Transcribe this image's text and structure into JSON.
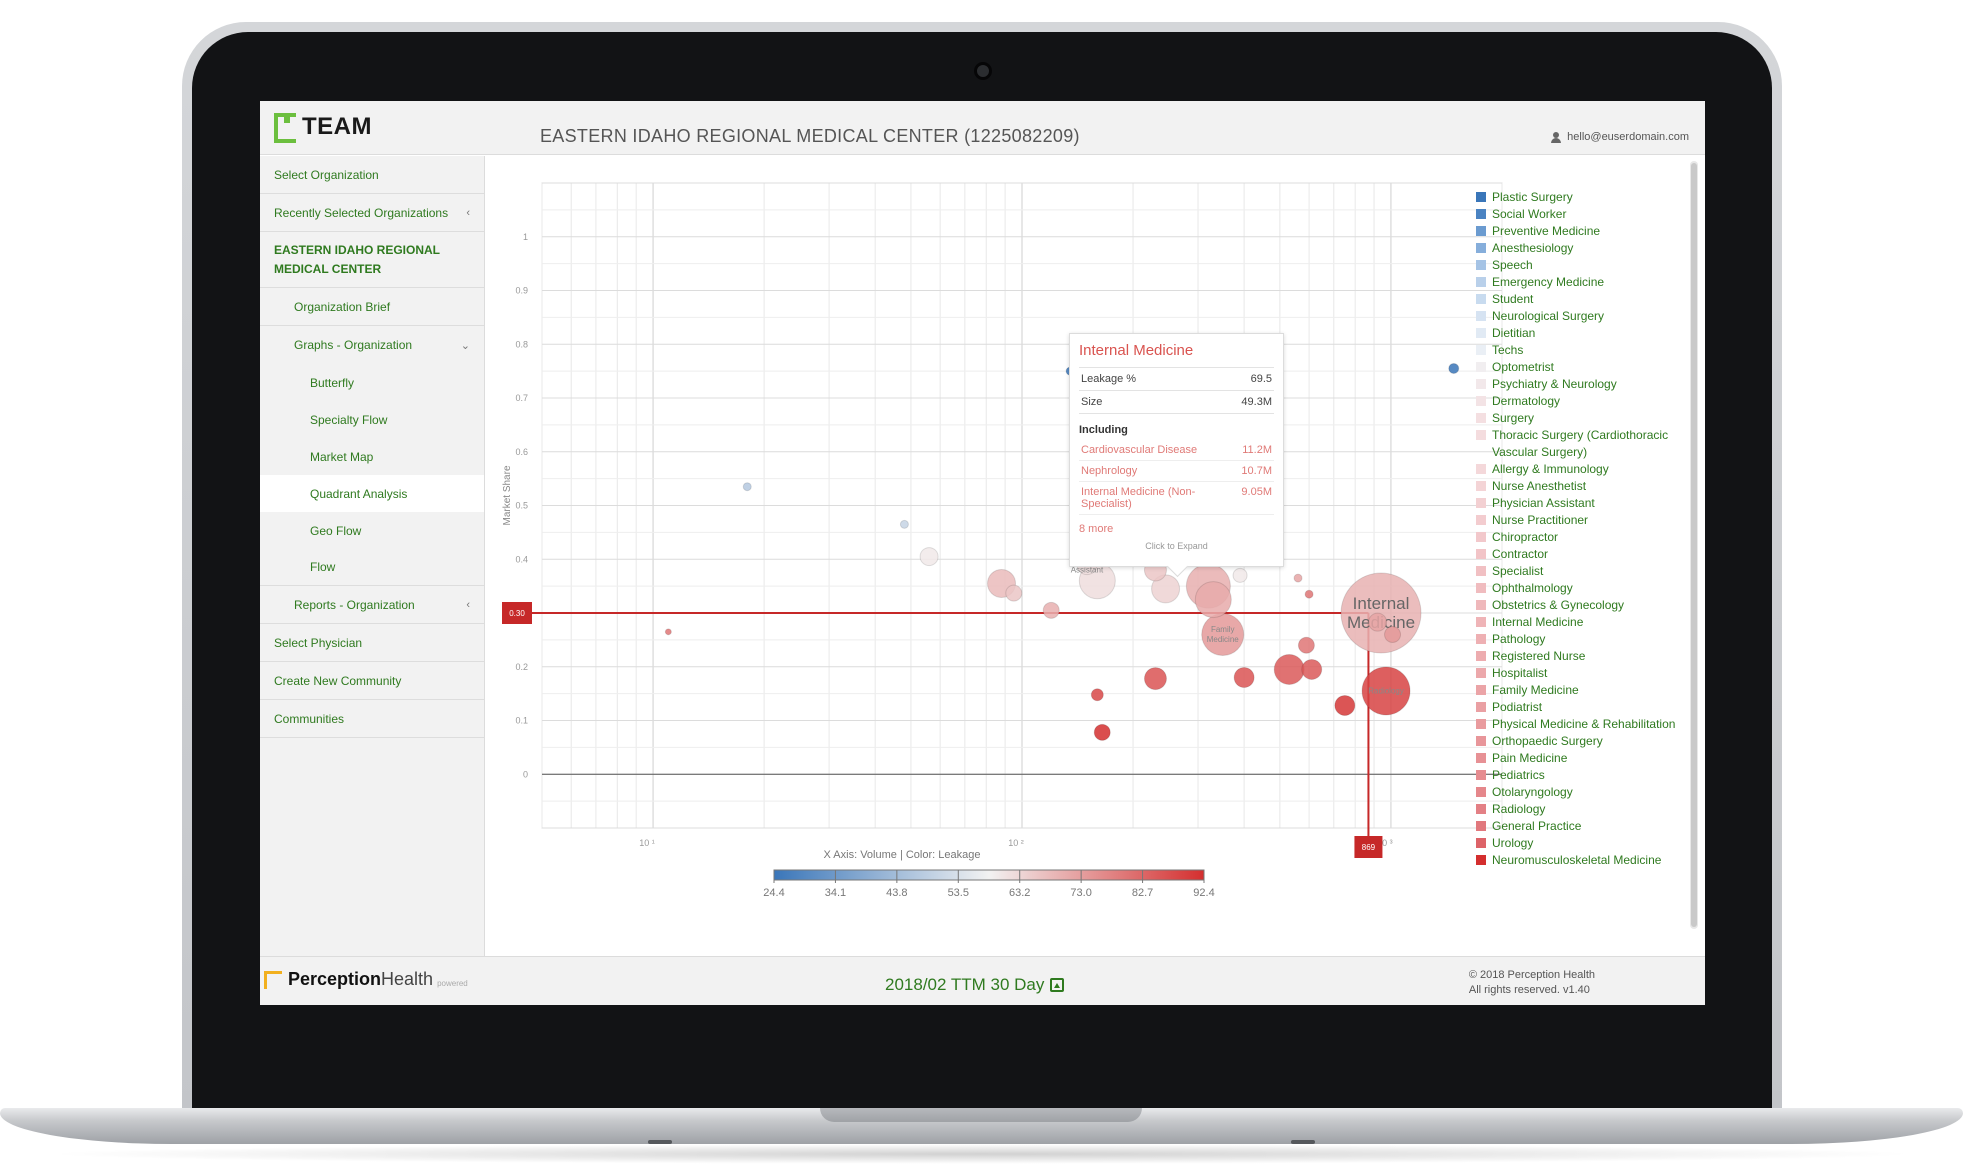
{
  "header": {
    "logo_text": "TEAM",
    "org_title": "EASTERN IDAHO REGIONAL MEDICAL CENTER (1225082209)",
    "user_email": "hello@euserdomain.com"
  },
  "sidebar": {
    "items": [
      {
        "label": "Select Organization"
      },
      {
        "label": "Recently Selected Organizations",
        "caret": "‹"
      },
      {
        "label": "EASTERN IDAHO REGIONAL MEDICAL CENTER"
      },
      {
        "label": "Organization Brief"
      },
      {
        "label": "Graphs - Organization",
        "caret": "⌄"
      },
      {
        "label": "Butterfly"
      },
      {
        "label": "Specialty Flow"
      },
      {
        "label": "Market Map"
      },
      {
        "label": "Quadrant Analysis"
      },
      {
        "label": "Geo Flow"
      },
      {
        "label": "Flow"
      },
      {
        "label": "Reports - Organization",
        "caret": "‹"
      },
      {
        "label": "Select Physician"
      },
      {
        "label": "Create New Community"
      },
      {
        "label": "Communities"
      }
    ]
  },
  "tooltip": {
    "title": "Internal Medicine",
    "leakage_label": "Leakage %",
    "leakage_value": "69.5",
    "size_label": "Size",
    "size_value": "49.3M",
    "including_label": "Including",
    "sub_items": [
      {
        "name": "Cardiovascular Disease",
        "value": "11.2M"
      },
      {
        "name": "Nephrology",
        "value": "10.7M"
      },
      {
        "name": "Internal Medicine (Non-Specialist)",
        "value": "9.05M"
      }
    ],
    "more": "8 more",
    "expand": "Click to Expand"
  },
  "footer": {
    "brand_bold": "Perception",
    "brand_light": "Health",
    "powered": "powered",
    "period": "2018/02 TTM 30 Day",
    "copyright_line1": "© 2018 Perception Health",
    "copyright_line2": "All rights reserved. v1.40"
  },
  "chart_data": {
    "type": "scatter",
    "xlabel": "X Axis: Volume | Color: Leakage",
    "ylabel": "Market Share",
    "x_scale": "log",
    "xlim": [
      5,
      2000
    ],
    "ylim": [
      -0.1,
      1.1
    ],
    "x_ticks": [
      {
        "value": 10,
        "label": "10 ¹"
      },
      {
        "value": 100,
        "label": "10 ²"
      },
      {
        "value": 1000,
        "label": "10 ³"
      }
    ],
    "y_ticks": [
      0,
      0.1,
      0.2,
      0.3,
      0.4,
      0.5,
      0.6,
      0.7,
      0.8,
      0.9,
      1
    ],
    "crosshair": {
      "x": 869,
      "y": 0.3,
      "x_label": "869",
      "y_label": "0.30"
    },
    "color_scale": {
      "ticks": [
        "24.4",
        "34.1",
        "43.8",
        "53.5",
        "63.2",
        "73.0",
        "82.7",
        "92.4"
      ],
      "low_color": "#3a76b9",
      "mid_color": "#f2f2f2",
      "high_color": "#d42f2f"
    },
    "grid": true,
    "points": [
      {
        "x": 135,
        "y": 0.75,
        "r": 4,
        "leak": 24.4
      },
      {
        "x": 1480,
        "y": 0.755,
        "r": 5,
        "leak": 24.4
      },
      {
        "x": 180,
        "y": 0.645,
        "r": 5,
        "leak": 33
      },
      {
        "x": 205,
        "y": 0.605,
        "r": 15,
        "leak": 37
      },
      {
        "x": 18,
        "y": 0.535,
        "r": 4,
        "leak": 47
      },
      {
        "x": 48,
        "y": 0.465,
        "r": 4,
        "leak": 50
      },
      {
        "x": 56,
        "y": 0.405,
        "r": 9,
        "leak": 60
      },
      {
        "x": 172,
        "y": 0.445,
        "r": 10,
        "leak": 53
      },
      {
        "x": 88,
        "y": 0.355,
        "r": 14,
        "leak": 68
      },
      {
        "x": 95,
        "y": 0.337,
        "r": 8,
        "leak": 66
      },
      {
        "x": 150,
        "y": 0.39,
        "r": 10,
        "leak": 62,
        "label": "Physician Assistant"
      },
      {
        "x": 160,
        "y": 0.36,
        "r": 18,
        "leak": 62
      },
      {
        "x": 230,
        "y": 0.38,
        "r": 11,
        "leak": 66
      },
      {
        "x": 245,
        "y": 0.345,
        "r": 14,
        "leak": 64
      },
      {
        "x": 320,
        "y": 0.35,
        "r": 22,
        "leak": 70
      },
      {
        "x": 330,
        "y": 0.325,
        "r": 18,
        "leak": 71
      },
      {
        "x": 390,
        "y": 0.37,
        "r": 7,
        "leak": 60
      },
      {
        "x": 120,
        "y": 0.305,
        "r": 8,
        "leak": 70
      },
      {
        "x": 350,
        "y": 0.26,
        "r": 21,
        "leak": 74,
        "label": "Family Medicine"
      },
      {
        "x": 560,
        "y": 0.365,
        "r": 4,
        "leak": 72
      },
      {
        "x": 600,
        "y": 0.335,
        "r": 4,
        "leak": 80
      },
      {
        "x": 590,
        "y": 0.24,
        "r": 8,
        "leak": 80
      },
      {
        "x": 530,
        "y": 0.195,
        "r": 15,
        "leak": 85
      },
      {
        "x": 610,
        "y": 0.195,
        "r": 10,
        "leak": 85
      },
      {
        "x": 400,
        "y": 0.18,
        "r": 10,
        "leak": 86
      },
      {
        "x": 230,
        "y": 0.178,
        "r": 11,
        "leak": 86
      },
      {
        "x": 160,
        "y": 0.148,
        "r": 6,
        "leak": 88
      },
      {
        "x": 11,
        "y": 0.265,
        "r": 3,
        "leak": 80
      },
      {
        "x": 970,
        "y": 0.155,
        "r": 24,
        "leak": 89,
        "label": "Radiology"
      },
      {
        "x": 750,
        "y": 0.128,
        "r": 10,
        "leak": 91
      },
      {
        "x": 165,
        "y": 0.078,
        "r": 8,
        "leak": 92.4
      },
      {
        "x": 940,
        "y": 0.3,
        "r": 40,
        "leak": 69.5,
        "label": "Internal Medicine"
      },
      {
        "x": 920,
        "y": 0.283,
        "r": 9,
        "leak": 72
      },
      {
        "x": 1010,
        "y": 0.26,
        "r": 8,
        "leak": 74
      }
    ],
    "legend": [
      {
        "name": "Plastic Surgery",
        "color": "#3a76b9"
      },
      {
        "name": "Social Worker",
        "color": "#4a83c2"
      },
      {
        "name": "Preventive Medicine",
        "color": "#6b9bd0"
      },
      {
        "name": "Anesthesiology",
        "color": "#86aedb"
      },
      {
        "name": "Speech",
        "color": "#a5c3e5"
      },
      {
        "name": "Emergency Medicine",
        "color": "#b9d0ea"
      },
      {
        "name": "Student",
        "color": "#c8dbef"
      },
      {
        "name": "Neurological Surgery",
        "color": "#d6e3f2"
      },
      {
        "name": "Dietitian",
        "color": "#e1eaf4"
      },
      {
        "name": "Techs",
        "color": "#eaeff5"
      },
      {
        "name": "Optometrist",
        "color": "#f1eef0"
      },
      {
        "name": "Psychiatry & Neurology",
        "color": "#f2e8ea"
      },
      {
        "name": "Dermatology",
        "color": "#f3e3e5"
      },
      {
        "name": "Surgery",
        "color": "#f4dfe1"
      },
      {
        "name": "Thoracic Surgery (Cardiothoracic Vascular Surgery)",
        "color": "#f4dcde"
      },
      {
        "name": "Allergy & Immunology",
        "color": "#f4d8da"
      },
      {
        "name": "Nurse Anesthetist",
        "color": "#f4d4d6"
      },
      {
        "name": "Physician Assistant",
        "color": "#f3d0d2"
      },
      {
        "name": "Nurse Practitioner",
        "color": "#f3cccf"
      },
      {
        "name": "Chiropractor",
        "color": "#f2c8cb"
      },
      {
        "name": "Contractor",
        "color": "#f2c4c7"
      },
      {
        "name": "Specialist",
        "color": "#f1c0c3"
      },
      {
        "name": "Ophthalmology",
        "color": "#f0bcbf"
      },
      {
        "name": "Obstetrics & Gynecology",
        "color": "#efb8bb"
      },
      {
        "name": "Internal Medicine",
        "color": "#efb4b7"
      },
      {
        "name": "Pathology",
        "color": "#eeb0b3"
      },
      {
        "name": "Registered Nurse",
        "color": "#edacaf"
      },
      {
        "name": "Hospitalist",
        "color": "#eca8ab"
      },
      {
        "name": "Family Medicine",
        "color": "#eba4a7"
      },
      {
        "name": "Podiatrist",
        "color": "#eaa0a3"
      },
      {
        "name": "Physical Medicine & Rehabilitation",
        "color": "#e99b9e"
      },
      {
        "name": "Orthopaedic Surgery",
        "color": "#e8969a"
      },
      {
        "name": "Pain Medicine",
        "color": "#e79195"
      },
      {
        "name": "Pediatrics",
        "color": "#e68c90"
      },
      {
        "name": "Otolaryngology",
        "color": "#e5878b"
      },
      {
        "name": "Radiology",
        "color": "#e38085"
      },
      {
        "name": "General Practice",
        "color": "#e1787d"
      },
      {
        "name": "Urology",
        "color": "#dd6368"
      },
      {
        "name": "Neuromusculoskeletal Medicine",
        "color": "#d42f2f"
      }
    ]
  }
}
